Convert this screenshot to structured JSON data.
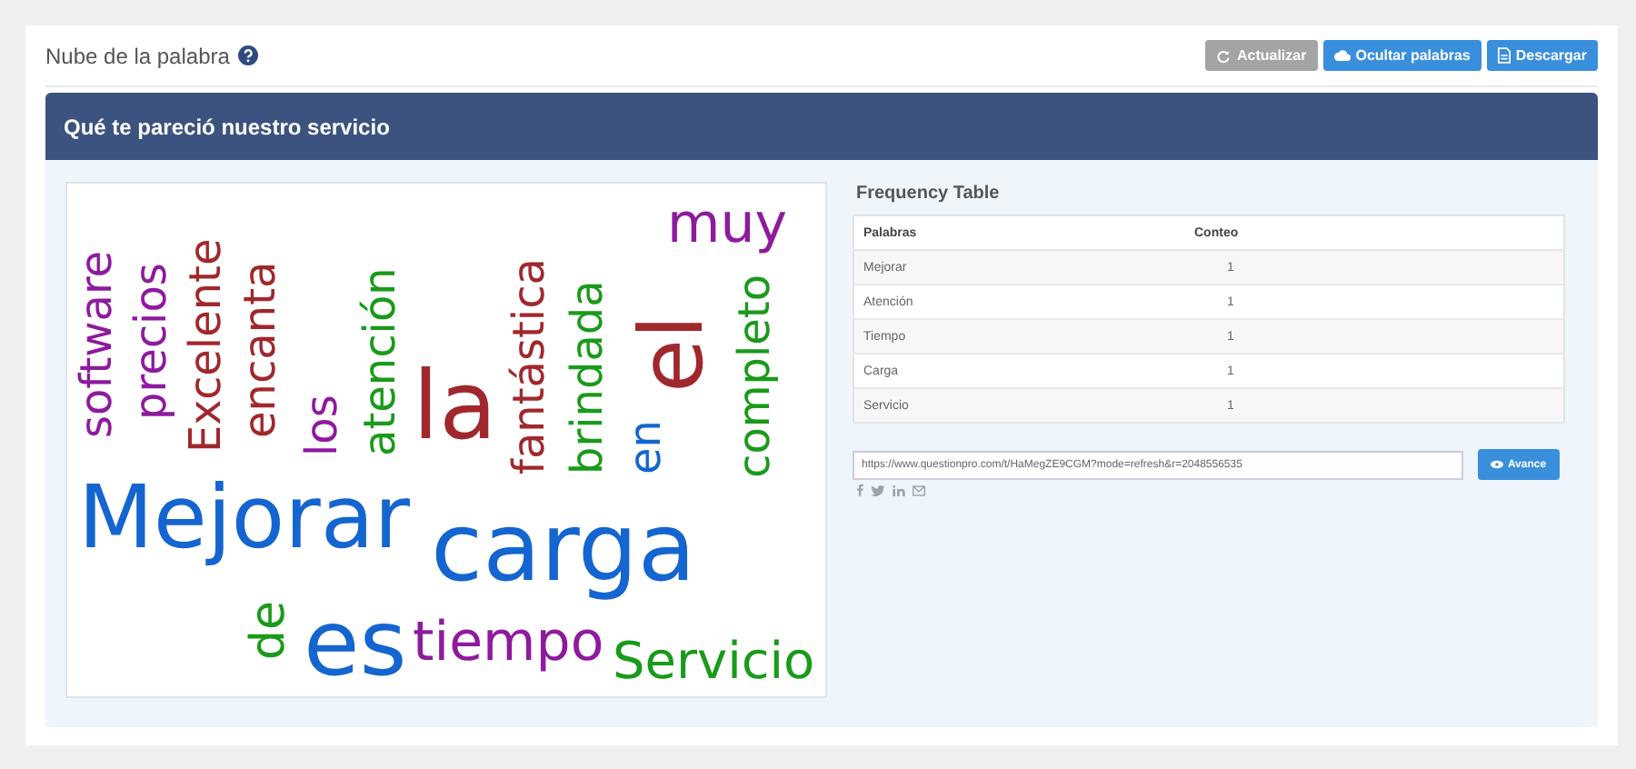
{
  "header": {
    "title": "Nube de la palabra",
    "buttons": [
      {
        "label": "Actualizar",
        "disabled": true
      },
      {
        "label": "Ocultar palabras",
        "disabled": false
      },
      {
        "label": "Descargar",
        "disabled": false
      }
    ]
  },
  "question": {
    "title": "Qué te pareció nuestro servicio"
  },
  "word_cloud": {
    "words": [
      {
        "text": "software",
        "color": "#8e1a9e"
      },
      {
        "text": "Mejorar",
        "color": "#1565d0"
      },
      {
        "text": "precios",
        "color": "#8e1a9e"
      },
      {
        "text": "Excelente",
        "color": "#a0282d"
      },
      {
        "text": "encanta",
        "color": "#a0282d"
      },
      {
        "text": "de",
        "color": "#1a9a1a"
      },
      {
        "text": "los",
        "color": "#8e1a9e"
      },
      {
        "text": "es",
        "color": "#1565d0"
      },
      {
        "text": "atención",
        "color": "#1a9a1a"
      },
      {
        "text": "la",
        "color": "#a0282d"
      },
      {
        "text": "carga",
        "color": "#1565d0"
      },
      {
        "text": "tiempo",
        "color": "#8e1a9e"
      },
      {
        "text": "fantástica",
        "color": "#a0282d"
      },
      {
        "text": "brindada",
        "color": "#1a9a1a"
      },
      {
        "text": "muy",
        "color": "#8e1a9e"
      },
      {
        "text": "el",
        "color": "#a0282d"
      },
      {
        "text": "en",
        "color": "#1565d0"
      },
      {
        "text": "completo",
        "color": "#1a9a1a"
      },
      {
        "text": "Servicio",
        "color": "#1a9a1a"
      }
    ]
  },
  "frequency_table": {
    "title": "Frequency Table",
    "columns": [
      "Palabras",
      "Conteo"
    ],
    "rows": [
      {
        "word": "Mejorar",
        "count": "1"
      },
      {
        "word": "Atención",
        "count": "1"
      },
      {
        "word": "Tiempo",
        "count": "1"
      },
      {
        "word": "Carga",
        "count": "1"
      },
      {
        "word": "Servicio",
        "count": "1"
      }
    ]
  },
  "share": {
    "url": "https://www.questionpro.com/t/HaMegZE9CGM?mode=refresh&r=2048556535",
    "button": "Avance"
  }
}
